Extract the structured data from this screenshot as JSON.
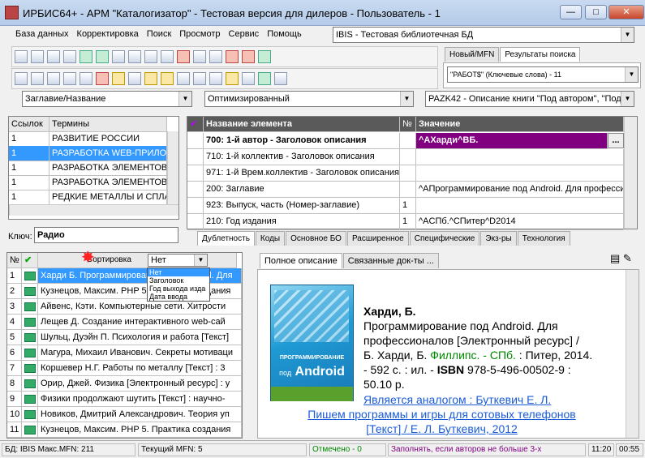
{
  "window": {
    "title": "ИРБИС64+ - АРМ \"Каталогизатор\" - Тестовая версия для дилеров - Пользователь - 1",
    "min": "—",
    "max": "□",
    "close": "✕"
  },
  "menu": [
    "База данных",
    "Корректировка",
    "Поиск",
    "Просмотр",
    "Сервис",
    "Помощь"
  ],
  "db_select": "IBIS - Тестовая библиотечная БД",
  "right_tabs": [
    "Новый/MFN",
    "Результаты поиска"
  ],
  "search_select": "\"РАБОТ$\" (Ключевые слова) - 11",
  "dict_select": "Заглавие/Название",
  "mode_select": "Оптимизированный",
  "format_select": "PAZK42 - Описание книги \"Под автором\", \"Под",
  "terms": {
    "headers": [
      "Ссылок",
      "Термины"
    ],
    "rows": [
      [
        "1",
        "РАЗВИТИЕ РОССИИ"
      ],
      [
        "1",
        "РАЗРАБОТКА WEB-ПРИЛОЖ"
      ],
      [
        "1",
        "РАЗРАБОТКА ЭЛЕМЕНТОВ"
      ],
      [
        "1",
        "РАЗРАБОТКА ЭЛЕМЕНТОВ"
      ],
      [
        "1",
        "РЕДКИЕ МЕТАЛЛЫ И СПЛА"
      ]
    ]
  },
  "key": {
    "label": "Ключ:",
    "value": "Радио"
  },
  "fields": {
    "headers": [
      "Название элемента",
      "№",
      "Значение"
    ],
    "rows": [
      [
        "700: 1-й  автор - Заголовок описания",
        "",
        "^AХарди^BБ."
      ],
      [
        "710: 1-й коллектив - Заголовок описания",
        "",
        ""
      ],
      [
        "971: 1-й Врем.коллектив - Заголовок описания",
        "",
        ""
      ],
      [
        "200: Заглавие",
        "",
        "^AПрограммирование под Android. Для професси"
      ],
      [
        "923: Выпуск, часть (Номер-заглавие)",
        "1",
        ""
      ],
      [
        "210: Год издания",
        "1",
        "^AСПб.^CПитер^D2014"
      ]
    ],
    "ellipsis": "..."
  },
  "field_tabs": [
    "Дублетность",
    "Коды",
    "Основное БО",
    "Расширенное",
    "Специфические",
    "Экз-ры",
    "Технология"
  ],
  "sort": {
    "label": "Сортировка",
    "value": "Нет",
    "options": [
      "Нет",
      "Заголовок",
      "Год выхода изда",
      "Дата ввода"
    ]
  },
  "results": {
    "header": "№",
    "check": "✔",
    "rows": [
      [
        "1",
        "Харди Б. Программирование под Android. Для"
      ],
      [
        "2",
        "Кузнецов, Максим. PHP 5. Практика создания"
      ],
      [
        "3",
        "Айвенс, Кэти. Компьютерные сети. Хитрости"
      ],
      [
        "4",
        "Лещев Д. Создание интерактивного web-сай"
      ],
      [
        "5",
        "Шульц, Дуэйн П. Психология и работа [Текст]"
      ],
      [
        "6",
        "Магура, Михаил Иванович. Секреты мотиваци"
      ],
      [
        "7",
        "Коршевер Н.Г. Работы по металлу [Текст] : 3"
      ],
      [
        "8",
        "Орир, Джей. Физика [Электронный ресурс] : у"
      ],
      [
        "9",
        "Физики продолжают шутить [Текст] : научно-"
      ],
      [
        "10",
        "Новиков, Дмитрий Александрович. Теория уп"
      ],
      [
        "11",
        "Кузнецов, Максим. PHP 5. Практика создания"
      ]
    ]
  },
  "desc_tabs": [
    "Полное описание",
    "Связанные док-ты ..."
  ],
  "book": {
    "cover_line1": "ПРОГРАММИРОВАНИЕ",
    "cover_line2": "под",
    "cover_line3": "Android",
    "author": "Харди, Б.",
    "title": "Программирование под Android. Для профессионалов [Электронный ресурс] /",
    "resp_a": "Б. Харди, Б. ",
    "resp_b": "Филлипс. - СПб.",
    "resp_c": " : Питер, 2014.",
    "pages": "- 592 с. : ил. - ",
    "isbn_label": "ISBN",
    "isbn": " 978-5-496-00502-9 :",
    "price": "50.10 р.",
    "link1": "Является аналогом : Буткевич Е. Л.",
    "link2": "Пишем программы и игры для сотовых телефонов",
    "link3": "[Текст] / Е. Л. Буткевич, 2012"
  },
  "status": {
    "db": "БД: IBIS Макс.MFN: 211",
    "mfn": "Текущий MFN: 5",
    "marked": "Отмечено - 0",
    "hint": "Заполнять, если авторов не больше 3-х",
    "time": "11:20",
    "time2": "00:55"
  },
  "colors": {
    "accent": "#3399ff",
    "purple": "#800080",
    "link": "#1a5bd8",
    "green": "#008000"
  }
}
